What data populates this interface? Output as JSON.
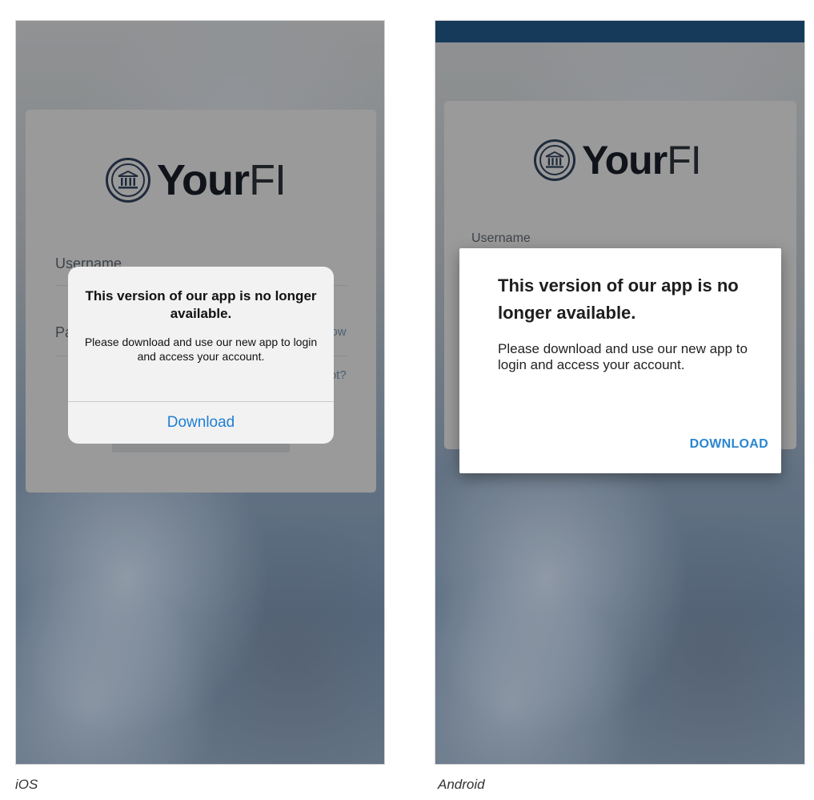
{
  "brand": {
    "name_bold": "Your",
    "name_light": "FI"
  },
  "login": {
    "username_label": "Username",
    "password_label": "Password",
    "show_label": "Show",
    "forgot_label": "Forgot?"
  },
  "dialog": {
    "title": "This version of our app is no longer available.",
    "message": "Please download and use our new app to login and access your account.",
    "ios_action": "Download",
    "android_action": "DOWNLOAD"
  },
  "captions": {
    "ios": "iOS",
    "android": "Android"
  },
  "colors": {
    "ios_action": "#1e7fd6",
    "android_action": "#2a86d1",
    "android_statusbar": "#163a5a"
  },
  "icons": {
    "logo": "bank-building-icon"
  }
}
